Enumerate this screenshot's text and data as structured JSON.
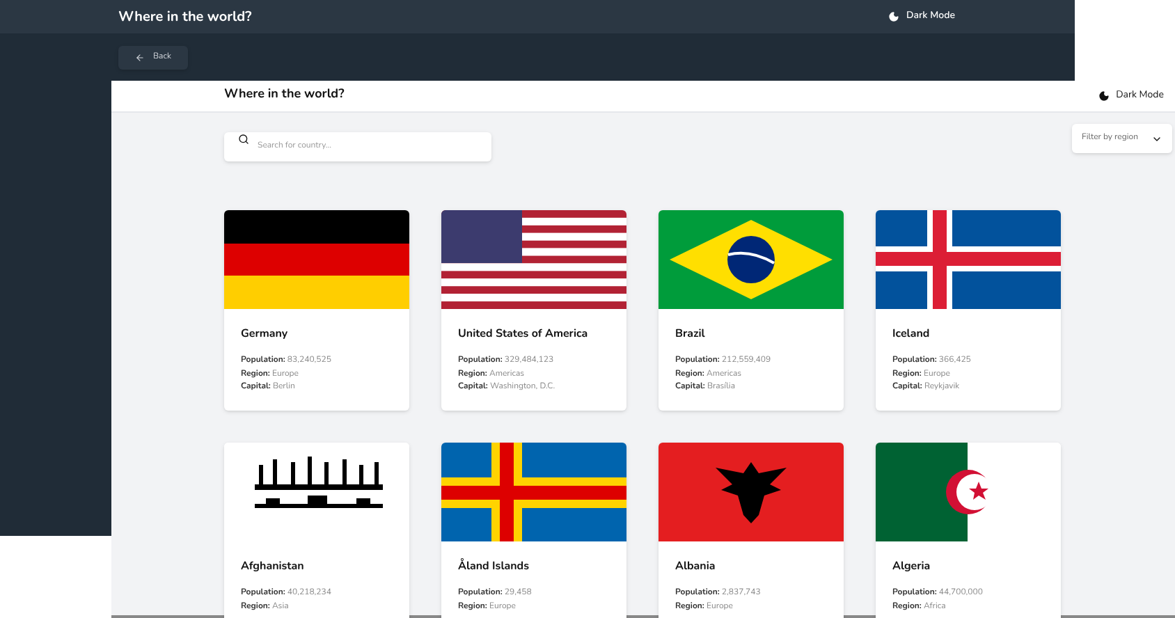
{
  "back_page": {
    "title": "Where in the world?",
    "theme_toggle": "Dark Mode",
    "back_button": "Back"
  },
  "page": {
    "title": "Where in the world?",
    "theme_toggle": "Dark Mode",
    "search": {
      "placeholder": "Search for country..."
    },
    "filter": {
      "label": "Filter by region"
    },
    "countries": [
      {
        "name": "Germany",
        "kind": "germany",
        "fields": [
          {
            "label": "Population:",
            "value": "83,240,525"
          },
          {
            "label": "Region:",
            "value": "Europe"
          },
          {
            "label": "Capital:",
            "value": "Berlin"
          }
        ]
      },
      {
        "name": "United States of America",
        "kind": "usa",
        "fields": [
          {
            "label": "Population:",
            "value": "329,484,123"
          },
          {
            "label": "Region:",
            "value": "Americas"
          },
          {
            "label": "Capital:",
            "value": "Washington, D.C."
          }
        ]
      },
      {
        "name": "Brazil",
        "kind": "brazil",
        "fields": [
          {
            "label": "Population:",
            "value": "212,559,409"
          },
          {
            "label": "Region:",
            "value": "Americas"
          },
          {
            "label": "Capital:",
            "value": "Brasília"
          }
        ]
      },
      {
        "name": "Iceland",
        "kind": "iceland",
        "fields": [
          {
            "label": "Population:",
            "value": "366,425"
          },
          {
            "label": "Region:",
            "value": "Europe"
          },
          {
            "label": "Capital:",
            "value": "Reykjavik"
          }
        ]
      },
      {
        "name": "Afghanistan",
        "kind": "afghanistan",
        "fields": [
          {
            "label": "Population:",
            "value": "40,218,234"
          },
          {
            "label": "Region:",
            "value": "Asia"
          }
        ]
      },
      {
        "name": "Åland Islands",
        "kind": "aland",
        "fields": [
          {
            "label": "Population:",
            "value": "29,458"
          },
          {
            "label": "Region:",
            "value": "Europe"
          }
        ]
      },
      {
        "name": "Albania",
        "kind": "albania",
        "fields": [
          {
            "label": "Population:",
            "value": "2,837,743"
          },
          {
            "label": "Region:",
            "value": "Europe"
          }
        ]
      },
      {
        "name": "Algeria",
        "kind": "algeria",
        "fields": [
          {
            "label": "Population:",
            "value": "44,700,000"
          },
          {
            "label": "Region:",
            "value": "Africa"
          }
        ]
      }
    ]
  }
}
